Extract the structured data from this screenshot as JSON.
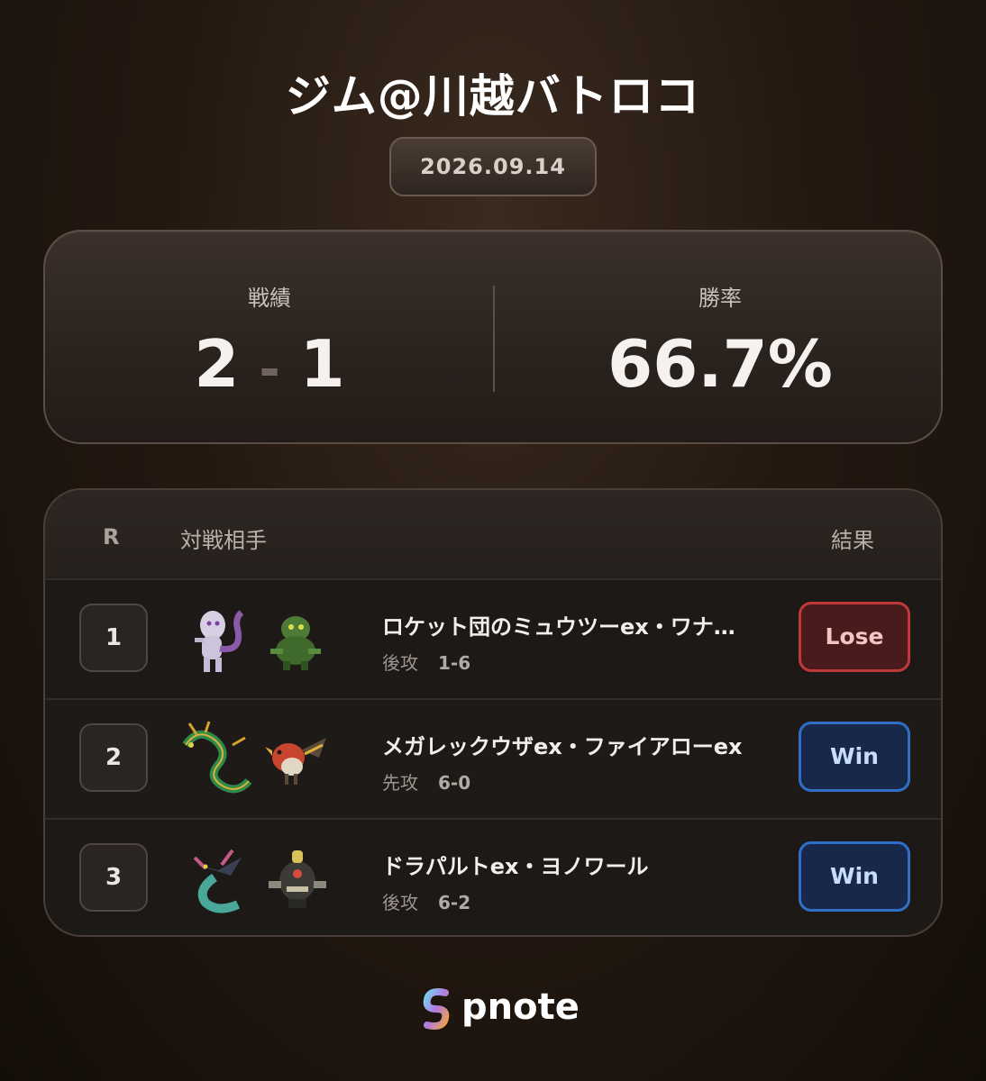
{
  "header": {
    "title": "ジム@川越バトロコ",
    "date": "2026.09.14"
  },
  "stats": {
    "record_label": "戦績",
    "wins": "2",
    "separator": "-",
    "losses": "1",
    "winrate_label": "勝率",
    "winrate": "66.7%"
  },
  "table": {
    "col_round": "R",
    "col_opponent": "対戦相手",
    "col_result": "結果",
    "rows": [
      {
        "round": "1",
        "deck": "ロケット団のミュウツーex・ワナ…",
        "turn": "後攻",
        "score": "1-6",
        "result": "Lose",
        "sprite_a": "mewtwo-icon",
        "sprite_b": "grass-pokemon-icon"
      },
      {
        "round": "2",
        "deck": "メガレックウザex・ファイアローex",
        "turn": "先攻",
        "score": "6-0",
        "result": "Win",
        "sprite_a": "rayquaza-icon",
        "sprite_b": "talonflame-icon"
      },
      {
        "round": "3",
        "deck": "ドラパルトex・ヨノワール",
        "turn": "後攻",
        "score": "6-2",
        "result": "Win",
        "sprite_a": "dragapult-icon",
        "sprite_b": "dusknoir-icon"
      }
    ]
  },
  "brand": {
    "name": "pnote",
    "logo": "pnote-logo-icon"
  },
  "colors": {
    "lose": "#c0393a",
    "win": "#2f6fc7"
  }
}
